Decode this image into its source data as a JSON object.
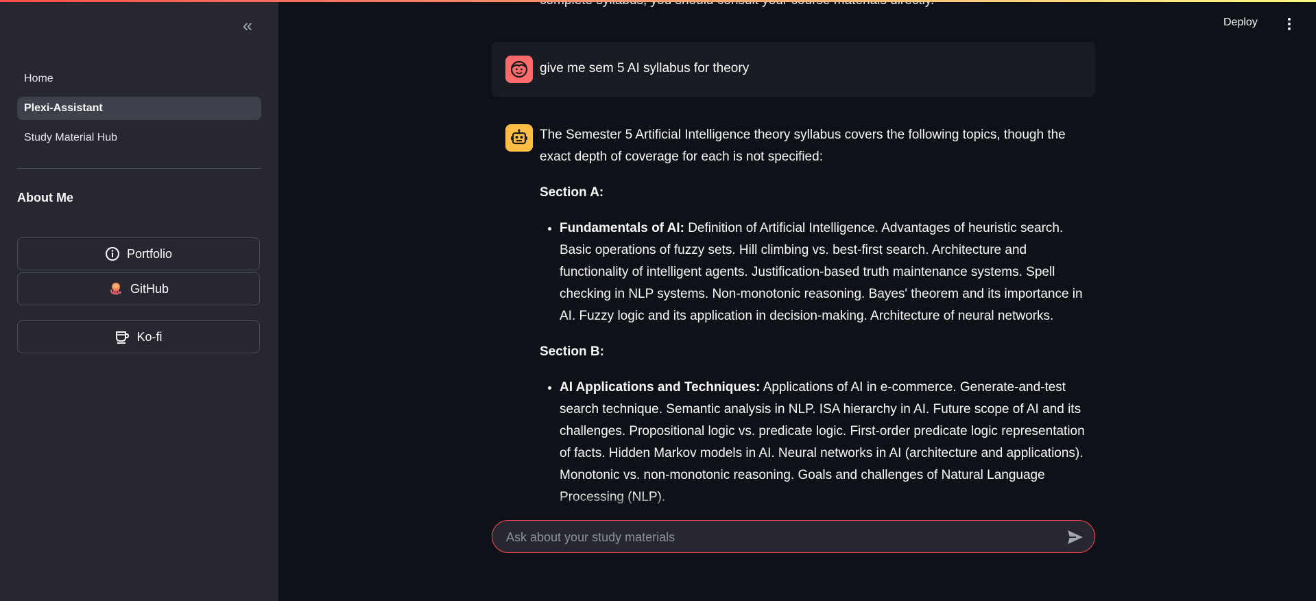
{
  "sidebar": {
    "collapse_icon": "double-chevron-left-icon",
    "nav": [
      {
        "label": "Home",
        "active": false
      },
      {
        "label": "Plexi-Assistant",
        "active": true
      },
      {
        "label": "Study Material Hub",
        "active": false
      }
    ],
    "about_title": "About Me",
    "links": [
      {
        "label": "Portfolio",
        "icon": "info-icon"
      },
      {
        "label": "GitHub",
        "icon": "octopus-icon"
      },
      {
        "label": "Ko-fi",
        "icon": "coffee-cup-icon"
      }
    ]
  },
  "header": {
    "deploy_label": "Deploy",
    "menu_icon": "kebab-menu-icon"
  },
  "chat": {
    "cut_off_text": "complete syllabus, you should consult your course materials directly.",
    "user_message": "give me sem 5 AI syllabus for theory",
    "bot": {
      "intro": "The Semester 5 Artificial Intelligence theory syllabus covers the following topics, though the exact depth of coverage for each is not specified:",
      "section_a_title": "Section A:",
      "section_a_item_title": "Fundamentals of AI:",
      "section_a_item_text": "Definition of Artificial Intelligence. Advantages of heuristic search. Basic operations of fuzzy sets. Hill climbing vs. best-first search. Architecture and functionality of intelligent agents. Justification-based truth maintenance systems. Spell checking in NLP systems. Non-monotonic reasoning. Bayes' theorem and its importance in AI. Fuzzy logic and its application in decision-making. Architecture of neural networks.",
      "section_b_title": "Section B:",
      "section_b_item_title": "AI Applications and Techniques:",
      "section_b_item_text": "Applications of AI in e-commerce. Generate-and-test search technique. Semantic analysis in NLP. ISA hierarchy in AI. Future scope of AI and its challenges. Propositional logic vs. predicate logic. First-order predicate logic representation of facts. Hidden Markov models in AI. Neural networks in AI (architecture and applications). Monotonic vs. non-monotonic reasoning. Goals and challenges of Natural Language Processing (NLP)."
    }
  },
  "input": {
    "placeholder": "Ask about your study materials",
    "value": "",
    "send_icon": "send-arrow-icon"
  },
  "colors": {
    "accent": "#ff4b4b",
    "user_avatar": "#ff6b6b",
    "bot_avatar": "#ffbd45",
    "sidebar_bg": "#262730",
    "main_bg": "#0e1117"
  }
}
